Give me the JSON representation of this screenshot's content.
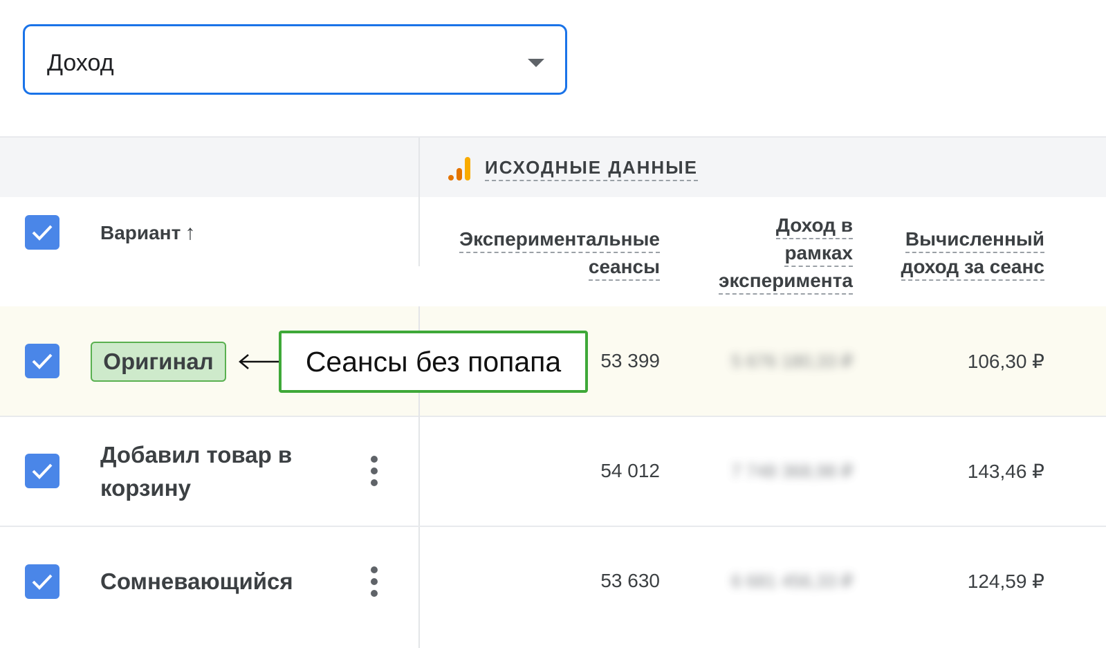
{
  "dropdown": {
    "value": "Доход"
  },
  "group": {
    "title": "ИСХОДНЫЕ ДАННЫЕ",
    "icon": "analytics-icon"
  },
  "columns": {
    "variant": "Вариант",
    "sessions": [
      "Экспериментальные",
      "сеансы"
    ],
    "revenue": [
      "Доход в",
      "рамках",
      "эксперимента"
    ],
    "revenue_per_session": [
      "Вычисленный",
      "доход за сеанс"
    ]
  },
  "annotation": {
    "text": "Сеансы без попапа"
  },
  "rows": [
    {
      "variant": "Оригинал",
      "sessions": "53 399",
      "revenue": "5 676 180,33 ₽",
      "revenue_per_session": "106,30 ₽"
    },
    {
      "variant": "Добавил товар в корзину",
      "variant_lines": [
        "Добавил товар в",
        "корзину"
      ],
      "sessions": "54 012",
      "revenue": "7 748 368,98 ₽",
      "revenue_per_session": "143,46 ₽"
    },
    {
      "variant": "Сомневающийся",
      "sessions": "53 630",
      "revenue": "6 681 456,33 ₽",
      "revenue_per_session": "124,59 ₽"
    }
  ],
  "colors": {
    "accent": "#1a73e8",
    "checkbox": "#4a86e8",
    "annotation": "#3ea838",
    "highlight_row": "#fcfbf1"
  }
}
